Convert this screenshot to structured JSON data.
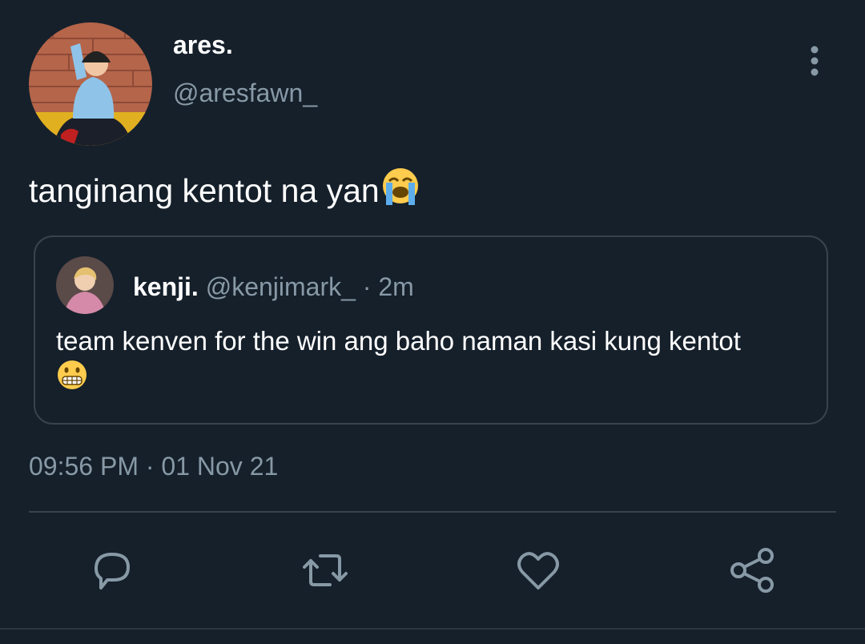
{
  "author": {
    "display_name": "ares.",
    "handle": "@aresfawn_"
  },
  "tweet": {
    "text": "tanginang kentot na yan",
    "emoji": "loudly-crying-face"
  },
  "quoted_tweet": {
    "display_name": "kenji.",
    "handle": "@kenjimark_",
    "separator": "·",
    "time_ago": "2m",
    "text": "team kenven for the win ang baho naman kasi kung kentot",
    "emoji": "grimacing-face"
  },
  "timestamp": {
    "time": "09:56 PM",
    "separator": "·",
    "date": "01 Nov 21"
  },
  "actions": [
    {
      "icon": "reply-icon"
    },
    {
      "icon": "retweet-icon"
    },
    {
      "icon": "like-icon"
    },
    {
      "icon": "share-icon"
    }
  ],
  "colors": {
    "background": "#15202b",
    "secondary_text": "#8899a6",
    "border": "#38444d",
    "icon": "#8899a6"
  }
}
